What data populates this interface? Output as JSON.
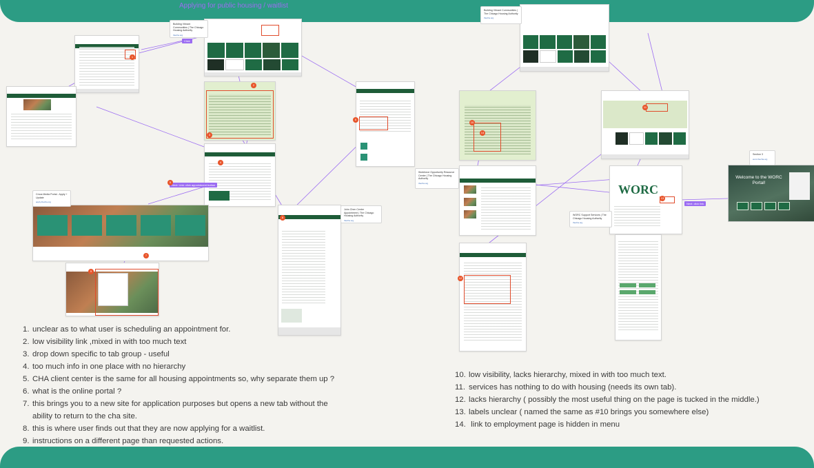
{
  "board": {
    "title": "Applying for public housing / waitlist"
  },
  "cards": [
    {
      "id": "bic",
      "text": "Building Vibrant Communities | The Chicago Housing Authority",
      "source": "thecha.org"
    },
    {
      "id": "bic2",
      "text": "Building Vibrant Communities | The Chicago Housing Authority",
      "source": "thecha.org"
    },
    {
      "id": "cma",
      "text": "Cmos Media Portal - Apply + Update",
      "source": "apply.thecha.org"
    },
    {
      "id": "cjc",
      "text": "John Chen Center Appointment | The Chicago Housing Authority",
      "source": "thecha.org"
    },
    {
      "id": "wors",
      "text": "Workforce Opportunity Resource Center | The Chicago Housing Authority",
      "source": "thecha.org"
    },
    {
      "id": "worcsup",
      "text": "WORC Support Services | The Chicago Housing Authority",
      "source": "thecha.org"
    },
    {
      "id": "sec3",
      "text": "Section 3",
      "source": "worc.thecha.org"
    }
  ],
  "tags": [
    {
      "id": "t1",
      "text": "Click"
    },
    {
      "id": "t2",
      "text": "Next: Link: click appointment button"
    },
    {
      "id": "t3",
      "text": "Next: click link"
    }
  ],
  "portal": {
    "welcome": "Welcome to the WORC Portal!"
  },
  "worc": {
    "logo": "WORC"
  },
  "notes_left": [
    {
      "n": "1.",
      "text": "unclear as to what user is scheduling an appointment for."
    },
    {
      "n": "2.",
      "text": "low visibility link ,mixed in with too much text"
    },
    {
      "n": "3.",
      "text": "drop down specific to tab group - useful"
    },
    {
      "n": "4.",
      "text": "too much info in one place with no hierarchy"
    },
    {
      "n": "5.",
      "text": "CHA client center is the same for all housing appointments so, why separate them up ?"
    },
    {
      "n": "6.",
      "text": "what is the online portal ?"
    },
    {
      "n": "7.",
      "text": "this brings you to a new site for application purposes but opens a new tab without the"
    },
    {
      "n": "",
      "text": "ability to return to the cha site."
    },
    {
      "n": "8.",
      "text": "this is where user finds out that they are now applying for a waitlist."
    },
    {
      "n": "9.",
      "text": "instructions on a different page than requested actions."
    }
  ],
  "notes_right": [
    {
      "n": "10.",
      "text": "low visibility, lacks hierarchy, mixed in with too much text."
    },
    {
      "n": "11.",
      "text": "services has nothing to do with housing (needs its own tab)."
    },
    {
      "n": "12.",
      "text": "lacks hierarchy ( possibly the most useful thing on the page is tucked in the middle.)"
    },
    {
      "n": "13.",
      "text": "labels unclear ( named the same as #10 brings you somewhere else)"
    },
    {
      "n": "14.",
      "text": " link to employment page is hidden in menu"
    }
  ],
  "badges": [
    "1",
    "2",
    "3",
    "4",
    "5",
    "6",
    "7",
    "8",
    "9",
    "10",
    "11",
    "12",
    "13",
    "14"
  ],
  "colors": {
    "band": "#2c9c84",
    "cha_green": "#1e5c38",
    "connector": "#9b6cf2",
    "highlight": "#e04b2b",
    "title": "#9b6cf2"
  }
}
